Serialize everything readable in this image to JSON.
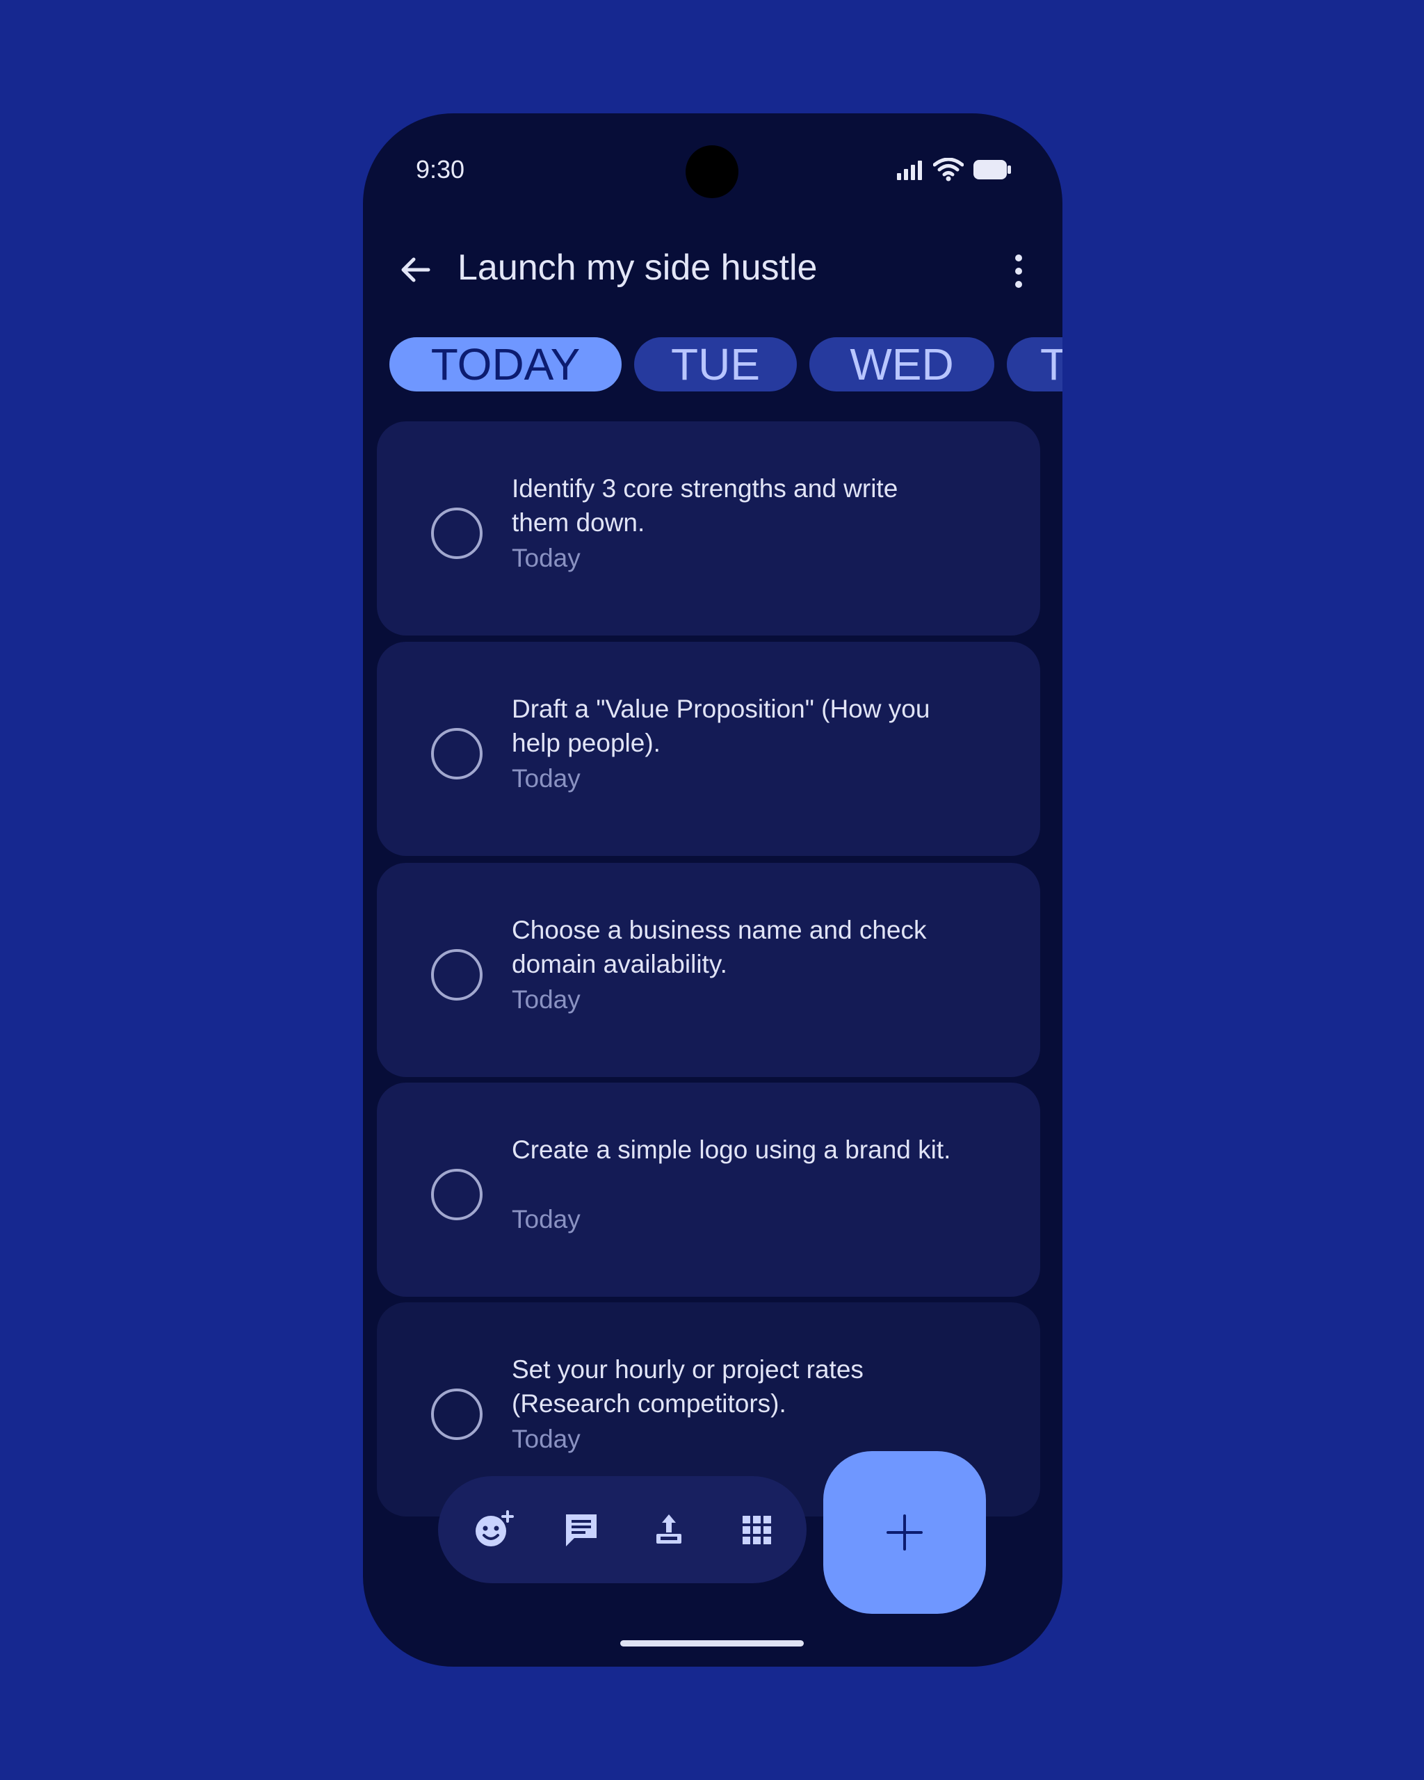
{
  "status_bar": {
    "time": "9:30",
    "icons": [
      "signal-icon",
      "wifi-icon",
      "battery-icon"
    ]
  },
  "app_bar": {
    "back_icon": "arrow-back-icon",
    "title": "Launch my side hustle",
    "menu_icon": "more-vert-icon"
  },
  "tabs": [
    {
      "label": "TODAY",
      "active": true
    },
    {
      "label": "TUE",
      "active": false
    },
    {
      "label": "WED",
      "active": false
    },
    {
      "label": "T",
      "active": false
    }
  ],
  "tasks": [
    {
      "title": "Identify 3 core strengths and write them down.",
      "due": "Today",
      "done": false
    },
    {
      "title": "Draft a \"Value Proposition\" (How you help people).",
      "due": "Today",
      "done": false
    },
    {
      "title": "Choose a business name and check domain availability.",
      "due": "Today",
      "done": false
    },
    {
      "title": "Create a simple logo using a brand kit.",
      "due": "Today",
      "done": false
    },
    {
      "title": "Set your hourly or project rates (Research competitors).",
      "due": "Today",
      "done": false
    }
  ],
  "toolbar": {
    "icons": [
      "add-reaction-icon",
      "chat-icon",
      "upload-icon",
      "apps-grid-icon"
    ]
  },
  "fab": {
    "icon": "plus-icon"
  },
  "colors": {
    "background": "#162890",
    "phone": "#070d38",
    "card": "#141b55",
    "accent": "#6f97ff",
    "tab": "#263a9e"
  }
}
